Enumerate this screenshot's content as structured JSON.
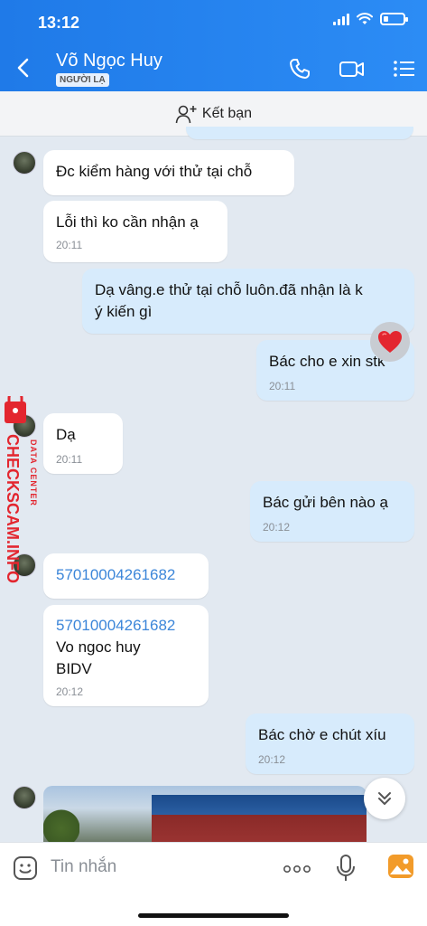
{
  "status_bar": {
    "time": "13:12"
  },
  "header": {
    "contact_name": "Võ Ngọc Huy",
    "badge": "NGƯỜI LẠ"
  },
  "friend_bar": {
    "label": "Kết bạn"
  },
  "messages": [
    {
      "direction": "in",
      "text": "Đc kiểm hàng với thử tại chỗ",
      "time": ""
    },
    {
      "direction": "in",
      "text": "Lỗi thì ko cần nhận ạ",
      "time": "20:11"
    },
    {
      "direction": "out",
      "lines": [
        "Dạ vâng.e thử tại chỗ luôn.đã nhận là k",
        "ý kiến gì"
      ],
      "time": ""
    },
    {
      "direction": "out",
      "text": "Bác cho e xin stk",
      "time": "20:11"
    },
    {
      "direction": "in",
      "text": "Dạ",
      "time": "20:11"
    },
    {
      "direction": "out",
      "text": "Bác gửi bên nào ạ",
      "time": "20:12"
    },
    {
      "direction": "in",
      "text": "57010004261682",
      "time": ""
    },
    {
      "direction": "in",
      "lines": [
        "57010004261682",
        "Vo ngoc huy",
        "BIDV"
      ],
      "time": "20:12"
    },
    {
      "direction": "out",
      "text": "Bác chờ e chút xíu",
      "time": "20:12"
    }
  ],
  "watermark": {
    "brand": "CHECKSCAM.INFO",
    "sub": "DATA CENTER"
  },
  "input_bar": {
    "placeholder": "Tin nhắn"
  },
  "colors": {
    "header": "#2c8cf5",
    "outgoing_bubble": "#d7ebfc",
    "incoming_bubble": "#ffffff",
    "link": "#3c86d9",
    "reaction_heart": "#e3262f"
  }
}
